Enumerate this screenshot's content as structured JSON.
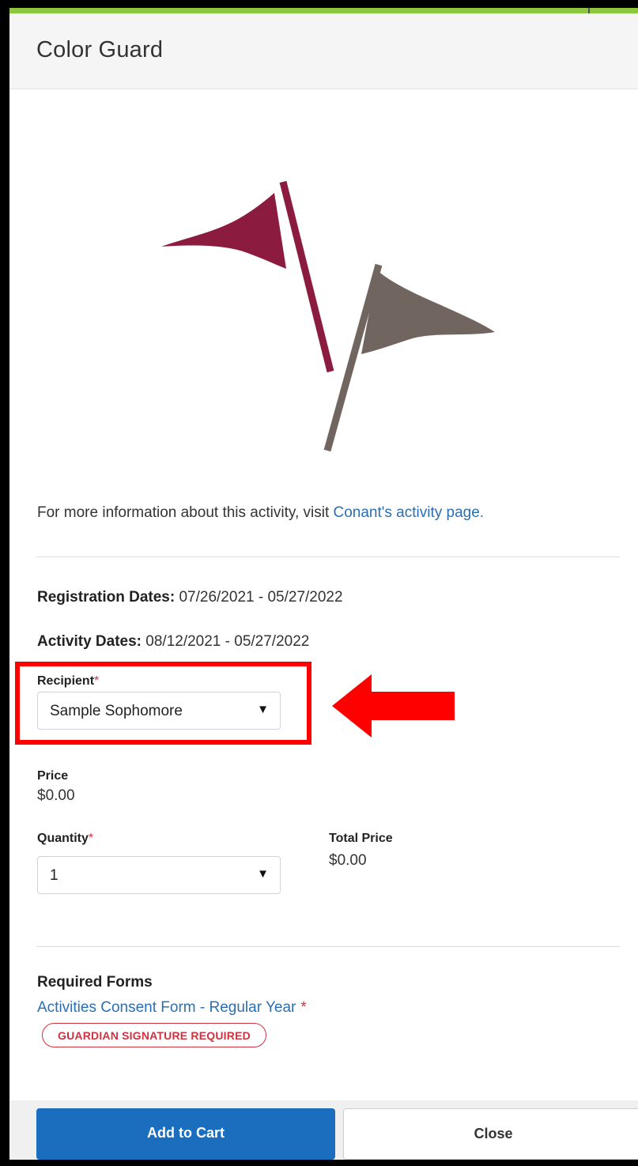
{
  "dialog": {
    "title": "Color Guard",
    "accent_color": "#8dc63f",
    "image_icon": "flags-icon"
  },
  "info": {
    "text": "For more information about this activity, visit ",
    "link_label": "Conant's activity page."
  },
  "dates": {
    "registration_label": "Registration Dates:",
    "registration_value": " 07/26/2021 - 05/27/2022",
    "activity_label": "Activity Dates:",
    "activity_value": " 08/12/2021 - 05/27/2022"
  },
  "recipient": {
    "label": "Recipient",
    "required_marker": "*",
    "selected": "Sample Sophomore",
    "caret": "▼"
  },
  "price": {
    "label": "Price",
    "value": "$0.00"
  },
  "quantity": {
    "label": "Quantity",
    "required_marker": "*",
    "selected": "1",
    "caret": "▼"
  },
  "total": {
    "label": "Total Price",
    "value": "$0.00"
  },
  "required_forms": {
    "title": "Required Forms",
    "form_link": "Activities Consent Form - Regular Year",
    "required_marker": "*",
    "badge": "GUARDIAN SIGNATURE REQUIRED"
  },
  "footer": {
    "add_to_cart": "Add to Cart",
    "close": "Close"
  },
  "colors": {
    "primary_button": "#1a6ebd",
    "link": "#2a6fb5",
    "required": "#d0323f",
    "flag_maroon": "#8b1c3f",
    "flag_gray": "#716560",
    "annotation": "#ff0000"
  }
}
